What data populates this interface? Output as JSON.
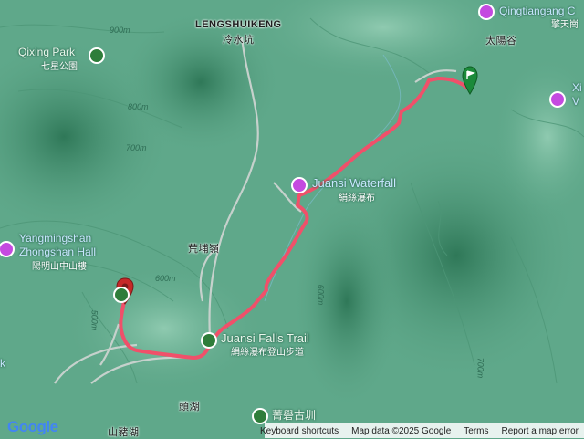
{
  "map": {
    "colors": {
      "terrain": "#5fa88a",
      "route": "#f0506a",
      "route_outline": "#e23a55",
      "road": "#c6d1cc",
      "poi_pink": "#c44ae0",
      "poi_green": "#2e7d3a",
      "start_marker": "#1b8a3a",
      "end_marker": "#c62828"
    },
    "places": {
      "lengshuikeng_en": "LENGSHUIKENG",
      "lengshuikeng_zh": "冷水坑",
      "huangpu_zh": "荒埔嶺",
      "toutou_zh": "頭湖",
      "shanzhuhu_zh": "山豬湖",
      "taiyanggu_zh": "太陽谷"
    },
    "pois": {
      "qixing_en": "Qixing Park",
      "qixing_zh": "七星公園",
      "qingtiangang_en": "Qingtiangang C",
      "qingtiangang_zh": "擎天崗",
      "x_label": "Xi",
      "v_label": "V",
      "waterfall_en": "Juansi Waterfall",
      "waterfall_zh": "絹絲瀑布",
      "zhongshan_en1": "Yangmingshan",
      "zhongshan_en2": "Zhongshan Hall",
      "zhongshan_zh": "陽明山中山樓",
      "trail_en": "Juansi Falls Trail",
      "trail_zh": "絹絲瀑布登山步道",
      "puti_zh": "菁礐古圳",
      "k_label": "k"
    },
    "contours": {
      "c900": "900m",
      "c800": "800m",
      "c700": "700m",
      "c600a": "600m",
      "c600b": "600m",
      "c500": "500m",
      "c700b": "700m"
    },
    "icons": {
      "camera": "camera-icon",
      "tree": "tree-icon",
      "hiker": "hiker-icon",
      "flag": "flag-icon",
      "pin": "pin-icon"
    }
  },
  "footer": {
    "shortcuts": "Keyboard shortcuts",
    "map_data": "Map data ©2025 Google",
    "terms": "Terms",
    "report": "Report a map error",
    "logo": "Google"
  }
}
